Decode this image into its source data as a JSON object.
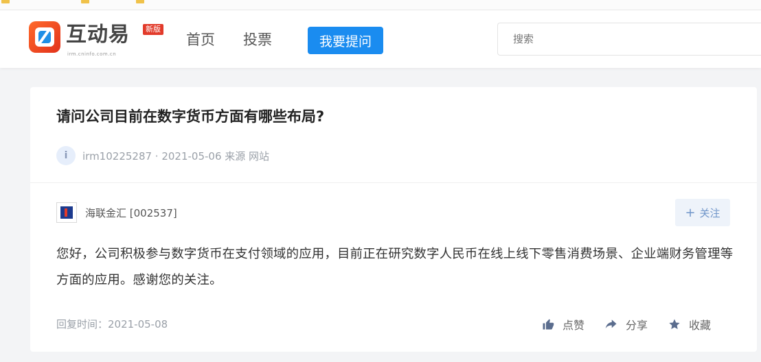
{
  "bookmarks": [
    "",
    "",
    ""
  ],
  "header": {
    "logo_name": "互动易",
    "logo_badge": "新版",
    "logo_sub": "irm.cninfo.com.cn",
    "nav": [
      "首页",
      "投票"
    ],
    "ask_button": "我要提问",
    "search_placeholder": "搜索"
  },
  "question": {
    "title": "请问公司目前在数字货币方面有哪些布局?",
    "avatar_letter": "i",
    "meta": "irm10225287  · 2021-05-06   来源 网站"
  },
  "answer": {
    "company": "海联金汇 [002537]",
    "follow_button": "关注",
    "text": "您好，公司积极参与数字货币在支付领域的应用，目前正在研究数字人民币在线上线下零售消费场景、企业端财务管理等方面的应用。感谢您的关注。",
    "reply_time": "回复时间：2021-05-08",
    "actions": {
      "like": "点赞",
      "share": "分享",
      "collect": "收藏"
    }
  },
  "colors": {
    "primary": "#1a8cf0",
    "follow_bg": "#eef3fa",
    "follow_text": "#6f95c9",
    "logo_orange": "#e2321b"
  }
}
